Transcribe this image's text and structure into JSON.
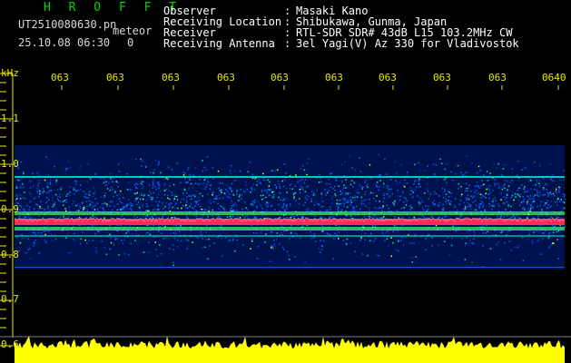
{
  "header": {
    "brand": "H R O F F T",
    "filename": "UT2510080630.pn",
    "tag": "meteor",
    "datetime": "25.10.08 06:30",
    "count": "0",
    "rows": [
      {
        "label": "Observer",
        "value": "Masaki Kano"
      },
      {
        "label": "Receiving Location",
        "value": "Shibukawa, Gunma, Japan"
      },
      {
        "label": "Receiver",
        "value": "RTL-SDR SDR# 43dB L15 103.2MHz CW"
      },
      {
        "label": "Receiving Antenna",
        "value": "3el Yagi(V) Az 330 for Vladivostok"
      }
    ]
  },
  "time_axis": {
    "labels": [
      "063",
      "063",
      "063",
      "063",
      "063",
      "063",
      "063",
      "063",
      "063",
      "0640"
    ]
  },
  "freq_axis": {
    "unit": "kHz",
    "labels": [
      "1.1",
      "1.0",
      "0.9",
      "0.8",
      "0.7",
      "0.6"
    ]
  },
  "colors": {
    "text_header": "#ffffff",
    "axis": "#e8e800",
    "brand": "#00d800",
    "background": "#000000",
    "noise_low": "#00208c",
    "noise_mid": "#0066ff",
    "signal": "#00e0c0",
    "carrier": "#ff2a5a",
    "level_bar": "#ffff00"
  }
}
